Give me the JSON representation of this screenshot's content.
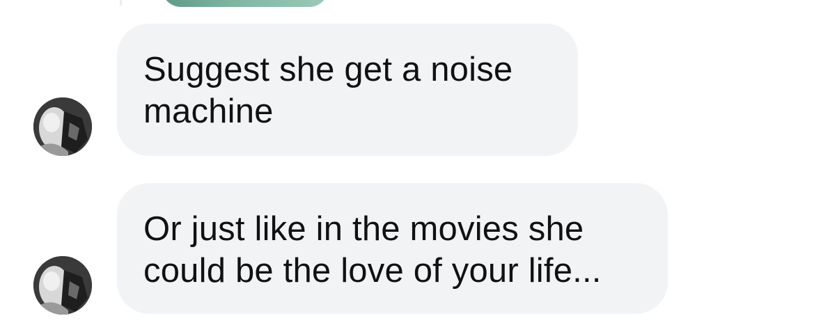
{
  "messages": [
    {
      "sender_avatar": "user-photo-avatar",
      "lines": [
        "Suggest she get a noise",
        "machine"
      ]
    },
    {
      "sender_avatar": "user-photo-avatar",
      "lines": [
        "Or just like in the movies she",
        "could be the love of your life..."
      ]
    }
  ],
  "colors": {
    "bubble_background": "#f2f3f5",
    "bubble_text": "#111111",
    "attachment_tint": "#7fb7a3",
    "page_background": "#ffffff"
  }
}
